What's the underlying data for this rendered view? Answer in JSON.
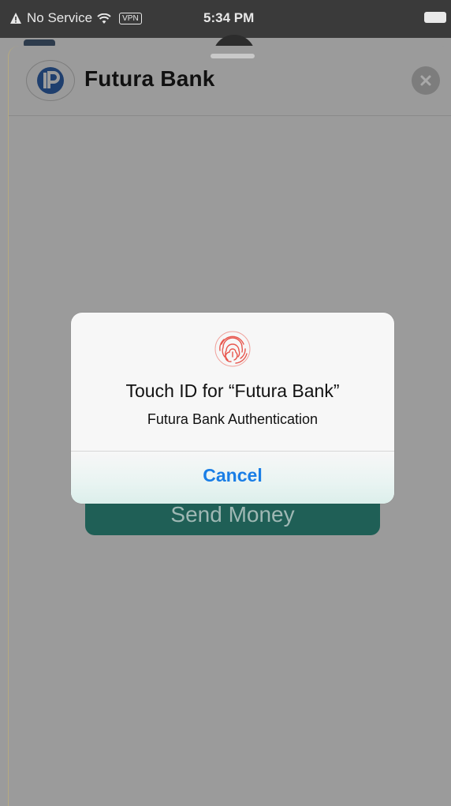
{
  "status_bar": {
    "carrier": "No Service",
    "vpn": "VPN",
    "time": "5:34 PM"
  },
  "sheet": {
    "app_name": "Futura Bank"
  },
  "background": {
    "send_money_label": "Send Money"
  },
  "alert": {
    "title": "Touch ID for “Futura Bank”",
    "message": "Futura Bank  Authentication",
    "cancel_label": "Cancel"
  },
  "colors": {
    "accent_blue": "#1a7ee6",
    "brand_green": "#1f5f56",
    "fingerprint_red": "#e8574e"
  },
  "icons": [
    "warning-icon",
    "wifi-icon",
    "battery-icon",
    "app-logo",
    "close-icon",
    "fingerprint-icon"
  ]
}
